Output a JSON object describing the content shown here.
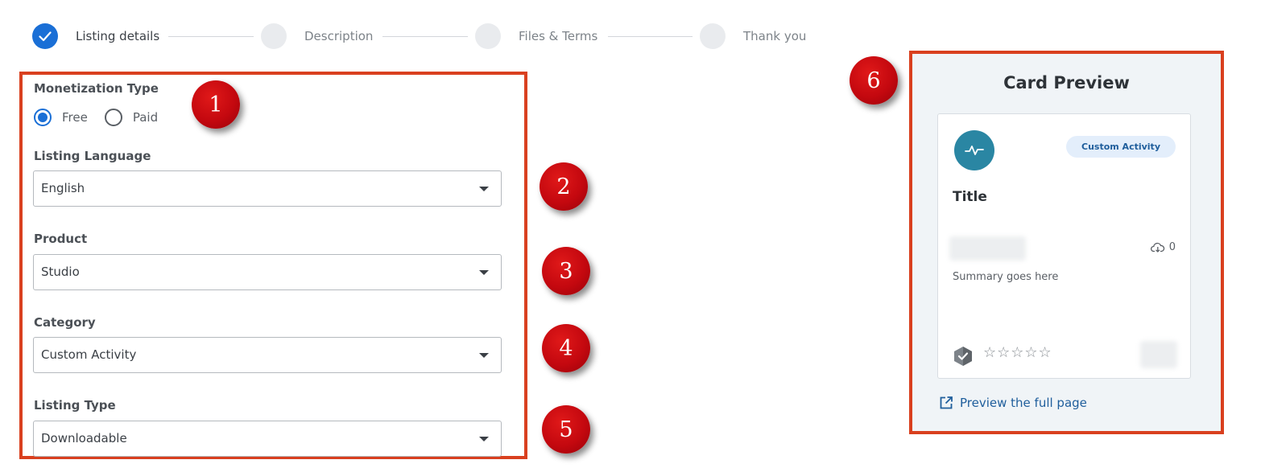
{
  "stepper": {
    "steps": [
      {
        "label": "Listing details",
        "state": "completed"
      },
      {
        "label": "Description",
        "state": "pending"
      },
      {
        "label": "Files & Terms",
        "state": "pending"
      },
      {
        "label": "Thank you",
        "state": "pending"
      }
    ]
  },
  "form": {
    "monetization": {
      "label": "Monetization Type",
      "options": [
        "Free",
        "Paid"
      ],
      "selected": "Free"
    },
    "language": {
      "label": "Listing Language",
      "value": "English"
    },
    "product": {
      "label": "Product",
      "value": "Studio"
    },
    "category": {
      "label": "Category",
      "value": "Custom Activity"
    },
    "listing_type": {
      "label": "Listing Type",
      "value": "Downloadable"
    }
  },
  "markers": [
    "1",
    "2",
    "3",
    "4",
    "5",
    "6"
  ],
  "preview": {
    "heading": "Card Preview",
    "card": {
      "icon": "activity-pulse-icon",
      "badge": "Custom Activity",
      "title": "Title",
      "downloads": "0",
      "summary": "Summary goes here",
      "rating": 0,
      "stars": "☆☆☆☆☆"
    },
    "link": "Preview the full page"
  },
  "colors": {
    "accent": "#1a6fd6",
    "highlight_border": "#d9401f",
    "marker": "#c4080f",
    "avatar": "#2a86a3"
  }
}
